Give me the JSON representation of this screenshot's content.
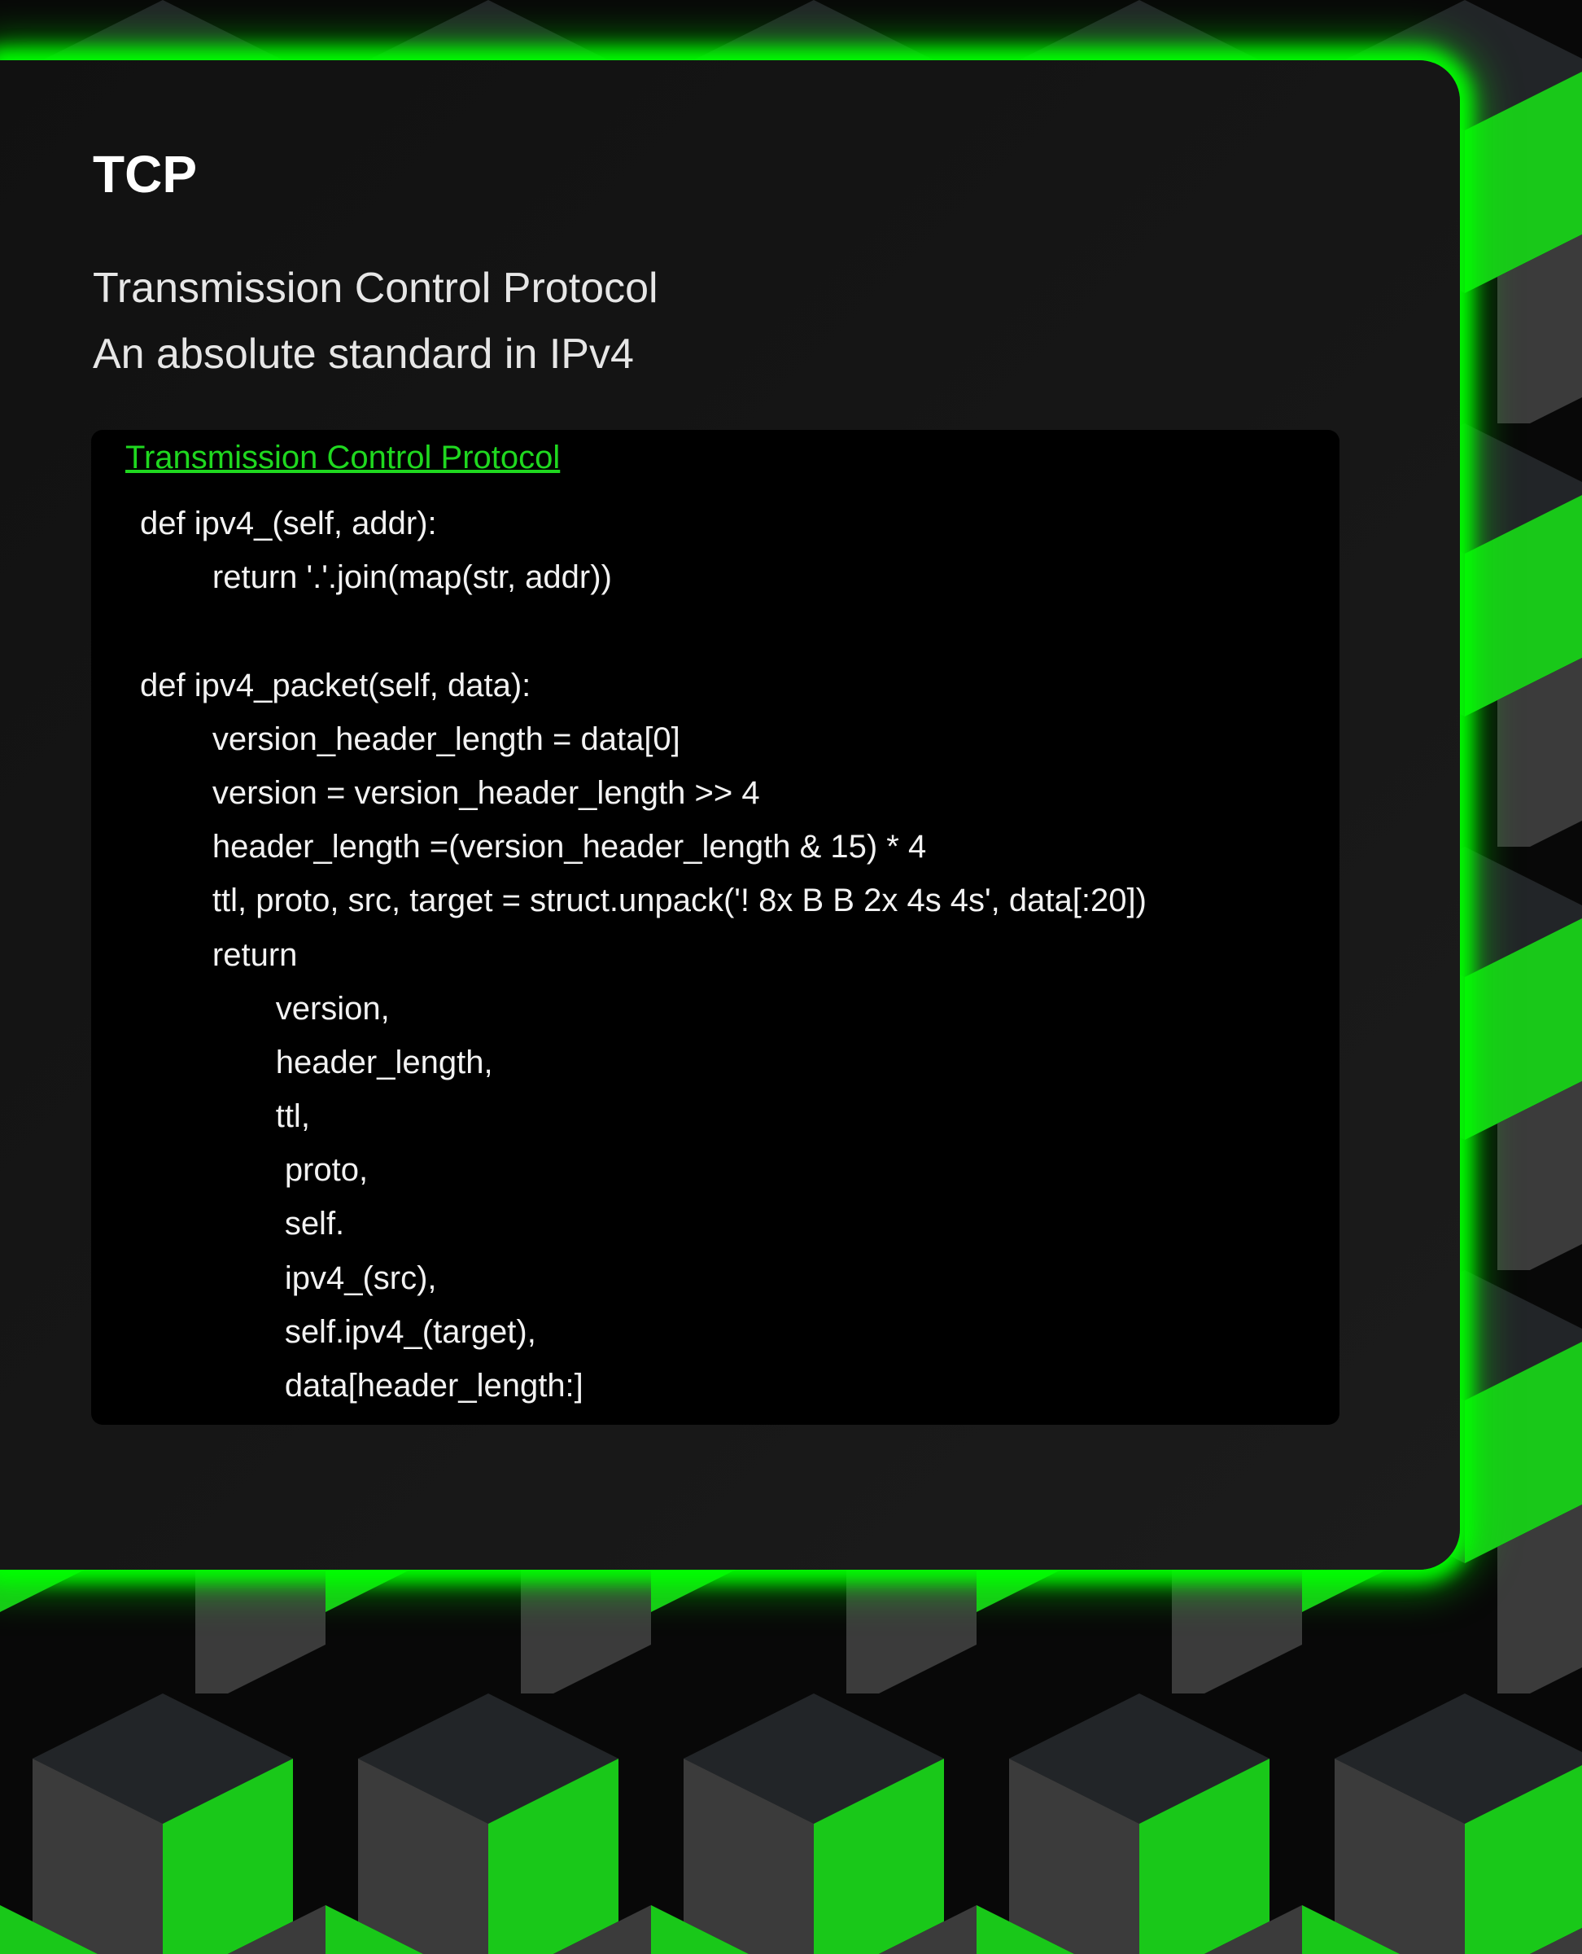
{
  "card": {
    "title": "TCP",
    "description_lines": [
      "Transmission Control Protocol",
      "An absolute standard in IPv4"
    ],
    "code_link": "Transmission Control Protocol",
    "code_lines": [
      "def ipv4_(self, addr):",
      "        return '.'.join(map(str, addr))",
      "",
      "def ipv4_packet(self, data):",
      "        version_header_length = data[0]",
      "        version = version_header_length >> 4",
      "        header_length =(version_header_length & 15) * 4",
      "        ttl, proto, src, target = struct.unpack('! 8x B B 2x 4s 4s', data[:20])",
      "        return",
      "               version,",
      "               header_length,",
      "               ttl,",
      "                proto,",
      "                self.",
      "                ipv4_(src),",
      "                self.ipv4_(target),",
      "                data[header_length:]"
    ]
  },
  "colors": {
    "accent": "#00ff00",
    "card_background": "#141414",
    "code_background": "#000000",
    "link": "#1fd81f"
  }
}
